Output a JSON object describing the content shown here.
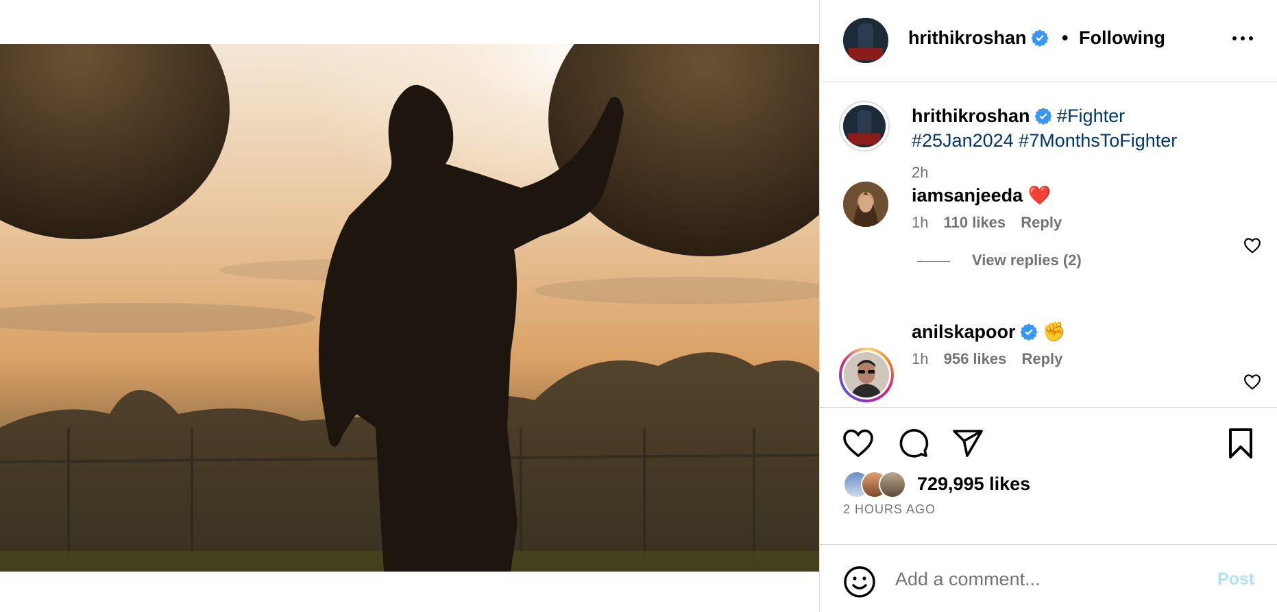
{
  "header": {
    "username": "hrithikroshan",
    "separator": "•",
    "follow_label": "Following"
  },
  "caption": {
    "username": "hrithikroshan",
    "hashtags": [
      "#Fighter",
      "#25Jan2024",
      "#7MonthsToFighter"
    ],
    "time": "2h"
  },
  "comments": [
    {
      "username": "iamsanjeeda",
      "text": "❤️",
      "time": "1h",
      "likes": "110 likes",
      "reply_label": "Reply",
      "view_replies": "View replies (2)"
    },
    {
      "username": "anilskapoor",
      "text": "✊",
      "time": "1h",
      "likes": "956 likes",
      "reply_label": "Reply"
    }
  ],
  "actions": {
    "likes_count": "729,995 likes",
    "posted_ago": "2 HOURS AGO"
  },
  "comment_box": {
    "placeholder": "Add a comment...",
    "post_label": "Post"
  },
  "icons": {
    "verified": "verified-badge-icon",
    "more": "more-options-icon",
    "like": "heart-icon",
    "comment": "comment-icon",
    "share": "share-icon",
    "save": "bookmark-icon",
    "emoji": "emoji-icon"
  },
  "colors": {
    "verified": "#3897f0",
    "hashtag": "#00376b",
    "muted": "#737373",
    "post_disabled": "#b2dffc"
  }
}
